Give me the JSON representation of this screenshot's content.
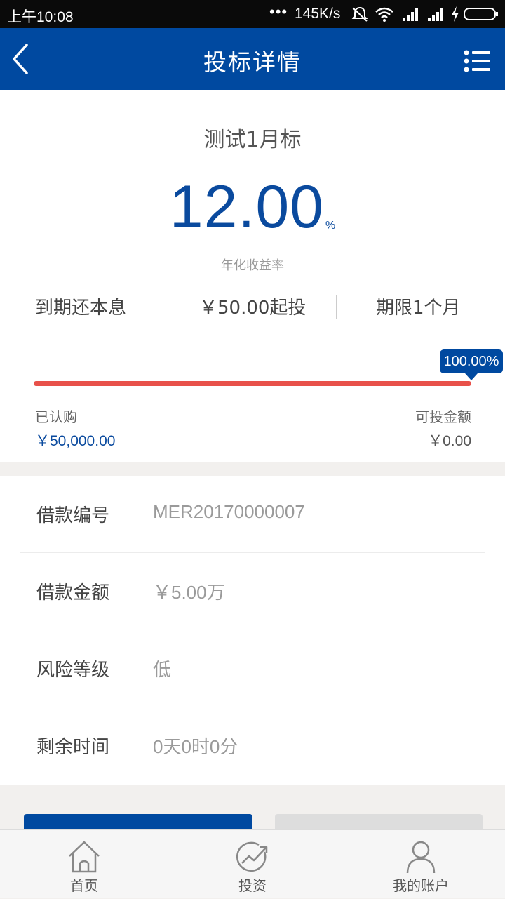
{
  "status_bar": {
    "time": "上午10:08",
    "dots": "•••",
    "network_speed": "145K/s",
    "icons": [
      "alarm-off-icon",
      "wifi-icon",
      "signal-icon",
      "signal-icon",
      "charging-icon",
      "battery-icon"
    ]
  },
  "header": {
    "title": "投标详情",
    "back_icon": "chevron-left-icon",
    "menu_icon": "list-menu-icon"
  },
  "product": {
    "name": "测试1月标",
    "rate_value": "12.00",
    "rate_unit": "%",
    "rate_label": "年化收益率",
    "repayment": "到期还本息",
    "min_invest": "￥50.00起投",
    "term": "期限1个月"
  },
  "progress": {
    "percent_text": "100.00%",
    "fraction": 1.0,
    "subscribed_label": "已认购",
    "subscribed_value": "￥50,000.00",
    "available_label": "可投金额",
    "available_value": "￥0.00"
  },
  "details": [
    {
      "label": "借款编号",
      "value": "MER20170000007"
    },
    {
      "label": "借款金额",
      "value": "￥5.00万"
    },
    {
      "label": "风险等级",
      "value": "低"
    },
    {
      "label": "剩余时间",
      "value": "0天0时0分"
    }
  ],
  "tabs": [
    {
      "label": "首页",
      "icon": "home-icon"
    },
    {
      "label": "投资",
      "icon": "invest-chart-icon"
    },
    {
      "label": "我的账户",
      "icon": "user-icon"
    }
  ],
  "colors": {
    "brand_blue": "#0049a0",
    "progress_red": "#e8514a"
  }
}
